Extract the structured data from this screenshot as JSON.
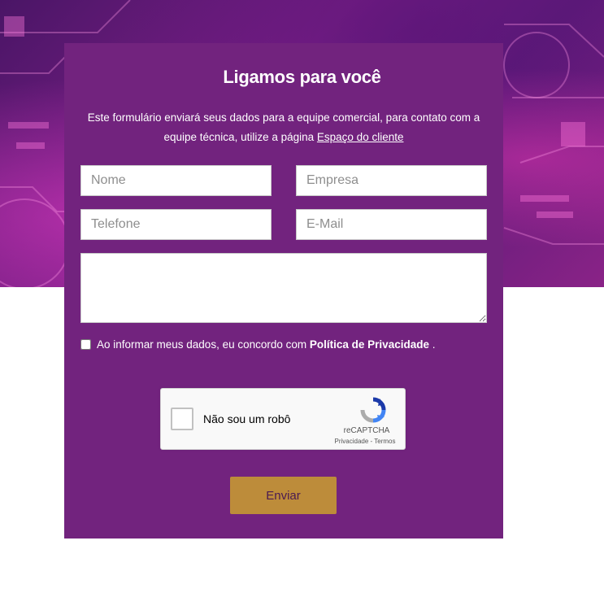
{
  "form": {
    "title": "Ligamos para você",
    "intro_text": "Este formulário enviará seus dados para a equipe comercial, para contato com a equipe técnica, utilize a página",
    "intro_link": "Espaço do cliente",
    "fields": {
      "name_placeholder": "Nome",
      "company_placeholder": "Empresa",
      "phone_placeholder": "Telefone",
      "email_placeholder": "E-Mail",
      "message_value": ""
    },
    "consent": {
      "text": "Ao informar meus dados, eu concordo com",
      "link": "Política de Privacidade",
      "suffix": "."
    },
    "captcha": {
      "label": "Não sou um robô",
      "brand": "reCAPTCHA",
      "privacy": "Privacidade",
      "separator": " - ",
      "terms": "Termos"
    },
    "submit_label": "Enviar"
  },
  "colors": {
    "card_background": "#72237e",
    "submit_background": "#bd8c3a",
    "submit_text": "#4a1a52"
  }
}
